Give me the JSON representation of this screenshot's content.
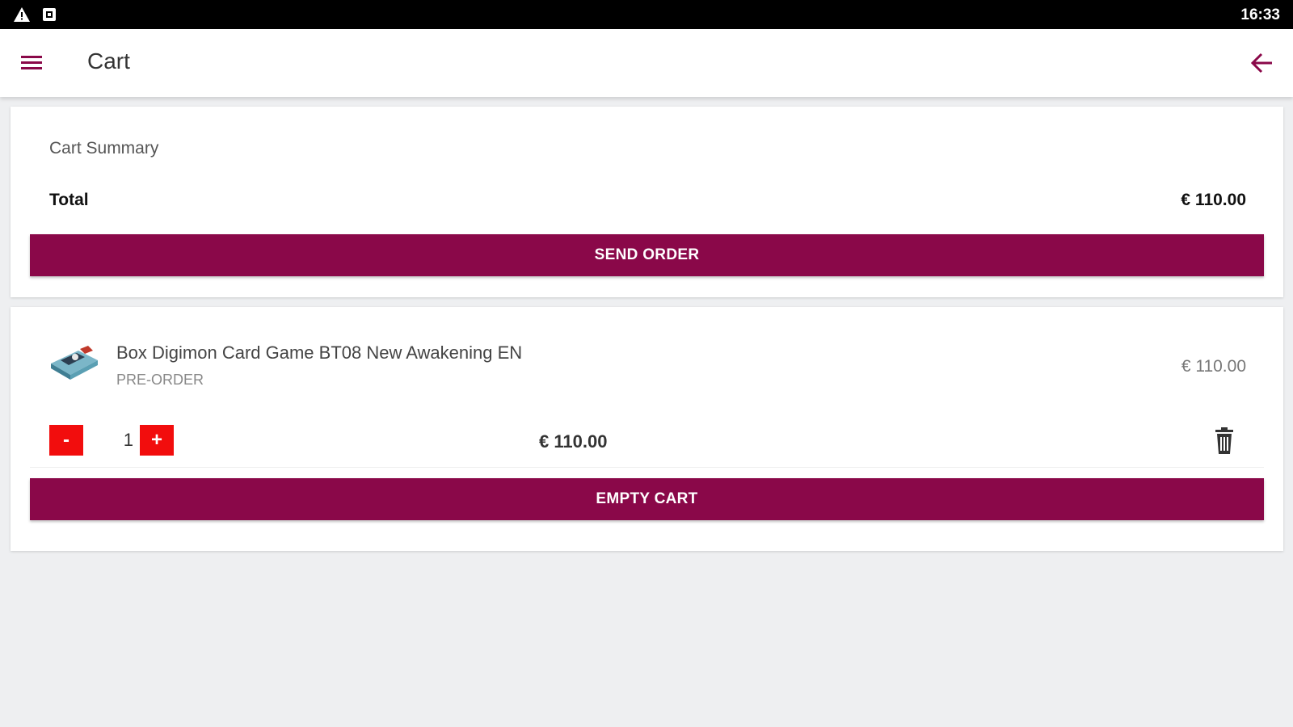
{
  "status_bar": {
    "time": "16:33",
    "icons": [
      "warning-icon",
      "notification-icon"
    ]
  },
  "app_bar": {
    "title": "Cart",
    "menu_icon": "hamburger-menu-icon",
    "back_icon": "arrow-back-icon"
  },
  "summary": {
    "title": "Cart Summary",
    "total_label": "Total",
    "total_value": "€ 110.00",
    "send_order_label": "SEND ORDER"
  },
  "cart": {
    "items": [
      {
        "name": "Box Digimon Card Game BT08 New Awakening EN",
        "status": "PRE-ORDER",
        "price": "€ 110.00",
        "quantity": "1",
        "line_total": "€ 110.00",
        "minus_label": "-",
        "plus_label": "+"
      }
    ],
    "empty_cart_label": "EMPTY CART"
  },
  "colors": {
    "primary": "#8a0849",
    "qty_button": "#f20d0d",
    "background": "#eeeff1"
  }
}
